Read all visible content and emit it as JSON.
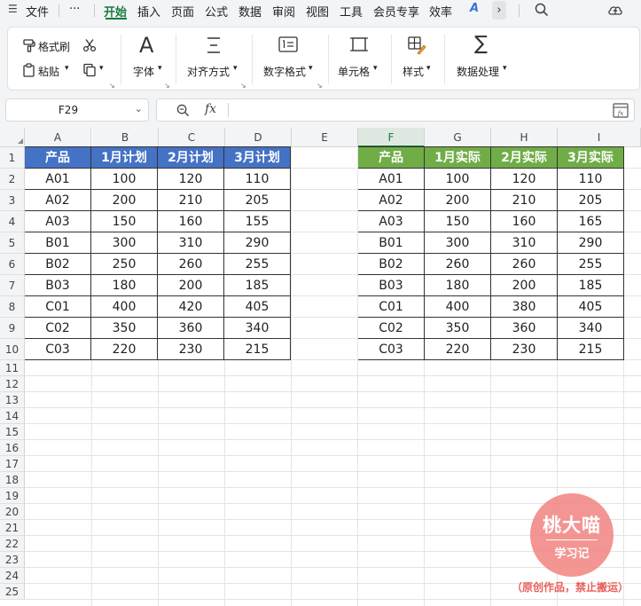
{
  "menubar": {
    "app_menu_label": "文件",
    "more_label": "···",
    "tabs": [
      "开始",
      "插入",
      "页面",
      "公式",
      "数据",
      "审阅",
      "视图",
      "工具",
      "会员专享",
      "效率"
    ]
  },
  "ribbon": {
    "format_painter": "格式刷",
    "paste": "粘贴",
    "font": "字体",
    "align": "对齐方式",
    "number_format": "数字格式",
    "cell": "单元格",
    "style": "样式",
    "data_processing": "数据处理"
  },
  "formula_bar": {
    "name_box": "F29",
    "fx_label": "fx",
    "formula": ""
  },
  "grid": {
    "columns": [
      "A",
      "B",
      "C",
      "D",
      "E",
      "F",
      "G",
      "H",
      "I"
    ],
    "selected_column": "F",
    "rows": [
      "1",
      "2",
      "3",
      "4",
      "5",
      "6",
      "7",
      "8",
      "9",
      "10",
      "11",
      "12",
      "13",
      "14",
      "15",
      "16",
      "17",
      "18",
      "19",
      "20",
      "21",
      "22",
      "23",
      "24",
      "25"
    ]
  },
  "plan_table": {
    "header_color": "#4472c4",
    "headers": [
      "产品",
      "1月计划",
      "2月计划",
      "3月计划"
    ],
    "rows": [
      [
        "A01",
        "100",
        "120",
        "110"
      ],
      [
        "A02",
        "200",
        "210",
        "205"
      ],
      [
        "A03",
        "150",
        "160",
        "155"
      ],
      [
        "B01",
        "300",
        "310",
        "290"
      ],
      [
        "B02",
        "250",
        "260",
        "255"
      ],
      [
        "B03",
        "180",
        "200",
        "185"
      ],
      [
        "C01",
        "400",
        "420",
        "405"
      ],
      [
        "C02",
        "350",
        "360",
        "340"
      ],
      [
        "C03",
        "220",
        "230",
        "215"
      ]
    ]
  },
  "actual_table": {
    "header_color": "#70ad47",
    "headers": [
      "产品",
      "1月实际",
      "2月实际",
      "3月实际"
    ],
    "rows": [
      [
        "A01",
        "100",
        "120",
        "110"
      ],
      [
        "A02",
        "200",
        "210",
        "205"
      ],
      [
        "A03",
        "150",
        "160",
        "165"
      ],
      [
        "B01",
        "300",
        "310",
        "290"
      ],
      [
        "B02",
        "260",
        "260",
        "255"
      ],
      [
        "B03",
        "180",
        "200",
        "185"
      ],
      [
        "C01",
        "400",
        "380",
        "405"
      ],
      [
        "C02",
        "350",
        "360",
        "340"
      ],
      [
        "C03",
        "220",
        "230",
        "215"
      ]
    ]
  },
  "watermark": {
    "title": "桃大喵",
    "subtitle": "学习记",
    "note": "（原创作品，禁止搬运）",
    "color": "#f28d89"
  }
}
